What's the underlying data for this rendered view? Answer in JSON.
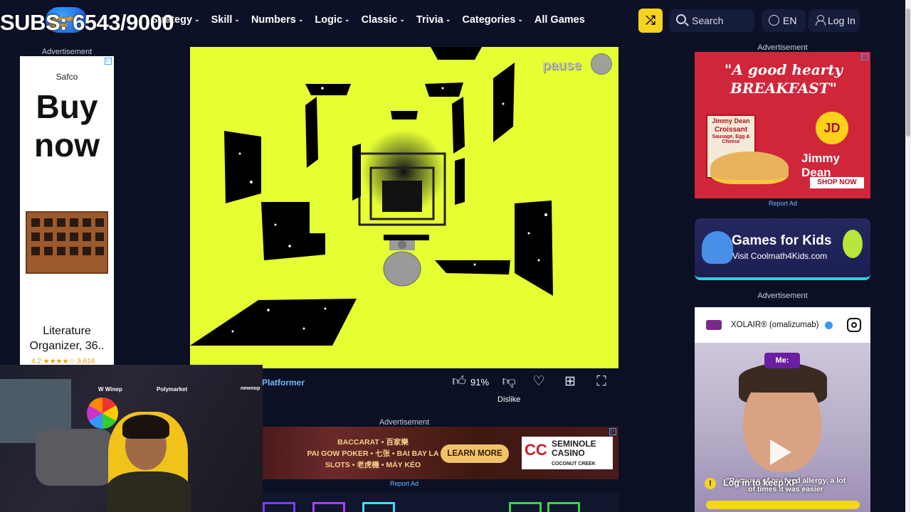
{
  "overlay": {
    "subs_text": "SUBS: 6543/9000"
  },
  "nav": {
    "logo_text": "Coolmath Games",
    "items": [
      {
        "label": "Strategy",
        "has_dropdown": true
      },
      {
        "label": "Skill",
        "has_dropdown": true
      },
      {
        "label": "Numbers",
        "has_dropdown": true
      },
      {
        "label": "Logic",
        "has_dropdown": true
      },
      {
        "label": "Classic",
        "has_dropdown": true
      },
      {
        "label": "Trivia",
        "has_dropdown": true
      },
      {
        "label": "Categories",
        "has_dropdown": true
      },
      {
        "label": "All Games",
        "has_dropdown": false
      }
    ],
    "chevron": "⌄",
    "shuffle_icon": "shuffle-icon",
    "search_placeholder": "Search",
    "language": "EN",
    "login_label": "Log In",
    "accent_color": "#f7d31f"
  },
  "left_ad": {
    "label": "Advertisement",
    "brand": "Safco",
    "headline_1": "Buy",
    "headline_2": "now",
    "product_line_1": "Literature",
    "product_line_2": "Organizer, 36..",
    "rating_text": "4.2 ★★★★☆ 3,616"
  },
  "game": {
    "background_color": "#e6ff33",
    "pause_text": "pause",
    "category_link": "Platformer",
    "like_percent": "91%",
    "dislike_tooltip": "Dislike",
    "toolbar_icons": [
      "thumbs-up-icon",
      "thumbs-down-icon",
      "heart-icon",
      "add-playlist-icon",
      "fullscreen-icon"
    ]
  },
  "center_ad": {
    "label": "Advertisement",
    "line_1": "BACCARAT • 百家樂",
    "line_2": "PAI GOW POKER • 七张 • BAI BAY LA",
    "line_3": "SLOTS • 老虎機 • MÁY KÉO",
    "button_label": "LEARN MORE",
    "casino_mark": "CC",
    "casino_line_1": "SEMINOLE",
    "casino_line_2": "CASINO",
    "casino_line_3": "COCONUT CREEK",
    "report": "Report Ad"
  },
  "right_ads": {
    "label_top": "Advertisement",
    "breakfast_headline": "\"A good hearty BREAKFAST\"",
    "box_brand": "Jimmy Dean",
    "box_product": "Croissant",
    "box_sub": "Sausage, Egg & Cheese",
    "brand": "Jimmy Dean",
    "burst_text": "JD",
    "cta": "SHOP NOW",
    "report": "Report Ad",
    "kids_title": "Games for Kids",
    "kids_sub": "Visit Coolmath4Kids.com",
    "label_bottom": "Advertisement",
    "insta_account": "XOLAIR® (omalizumab)",
    "insta_tag": "Me:",
    "insta_caption": "\"Because of my food allergy, a lot of times it was easier",
    "insta_overlay": "Log in to keep XP"
  }
}
